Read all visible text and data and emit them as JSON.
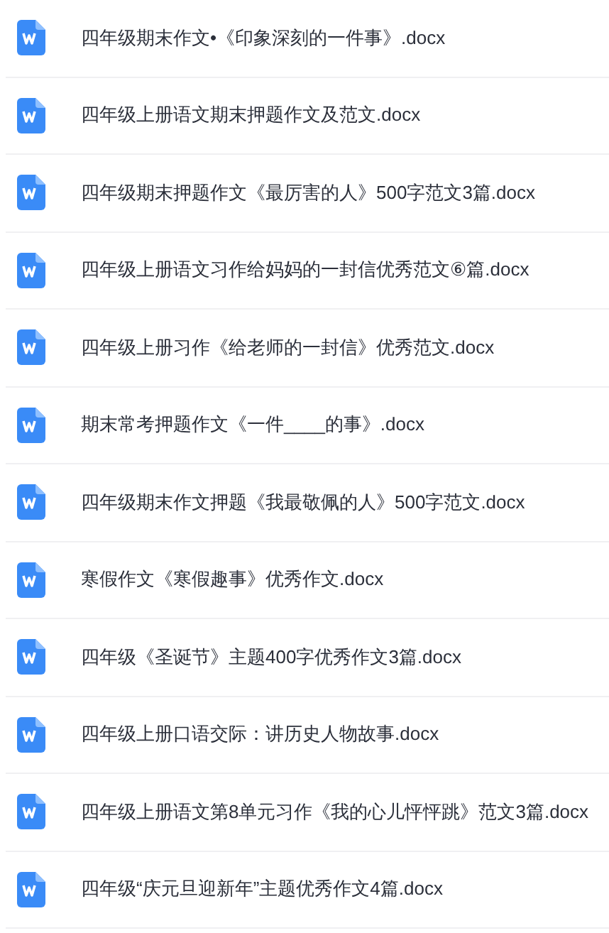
{
  "files": [
    {
      "name": "四年级期末作文•《印象深刻的一件事》.docx"
    },
    {
      "name": "四年级上册语文期末押题作文及范文.docx"
    },
    {
      "name": "四年级期末押题作文《最厉害的人》500字范文3篇.docx"
    },
    {
      "name": "四年级上册语文习作给妈妈的一封信优秀范文⑥篇.docx"
    },
    {
      "name": "四年级上册习作《给老师的一封信》优秀范文.docx"
    },
    {
      "name": "期末常考押题作文《一件____的事》.docx"
    },
    {
      "name": "四年级期末作文押题《我最敬佩的人》500字范文.docx"
    },
    {
      "name": "寒假作文《寒假趣事》优秀作文.docx"
    },
    {
      "name": "四年级《圣诞节》主题400字优秀作文3篇.docx"
    },
    {
      "name": "四年级上册口语交际：讲历史人物故事.docx"
    },
    {
      "name": "四年级上册语文第8单元习作《我的心儿怦怦跳》范文3篇.docx"
    },
    {
      "name": "四年级“庆元旦迎新年”主题优秀作文4篇.docx"
    }
  ]
}
